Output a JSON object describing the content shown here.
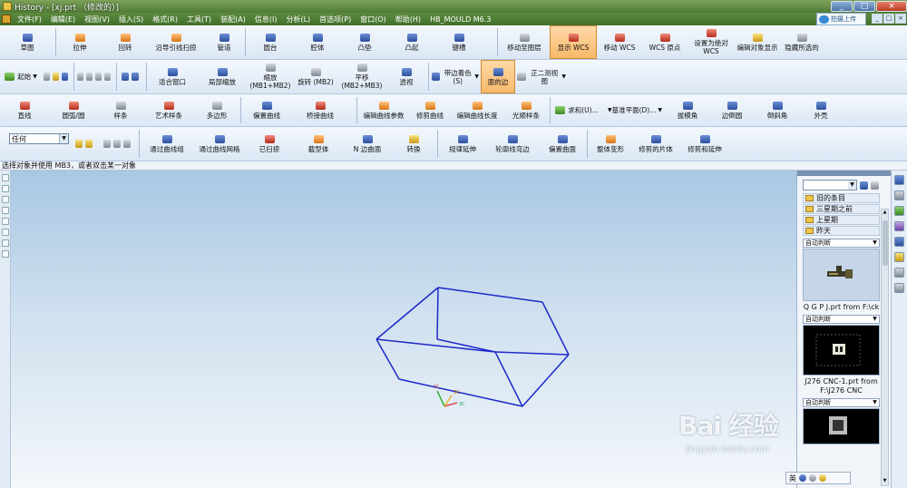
{
  "window": {
    "title": "History - [xj.prt （修改的）]",
    "controls": [
      "_",
      "□",
      "×"
    ]
  },
  "menu": {
    "items": [
      "文件(F)",
      "编辑(E)",
      "视图(V)",
      "插入(S)",
      "格式(R)",
      "工具(T)",
      "装配(A)",
      "信息(I)",
      "分析(L)",
      "首选项(P)",
      "窗口(O)",
      "帮助(H)",
      "HB_MOULD M6.3"
    ],
    "cloud_button": "拍摄上传",
    "doc_controls": [
      "_",
      "□",
      "×"
    ]
  },
  "toolbar1": {
    "items": [
      "草图",
      "拉伸",
      "回转",
      "沿导引线扫掠",
      "管道",
      "圆台",
      "腔体",
      "凸垫",
      "凸起",
      "键槽",
      "移动至图层",
      "显示 WCS",
      "移动 WCS",
      "WCS 原点",
      "设置为绝对 WCS",
      "编辑对象显示",
      "隐藏所选的"
    ],
    "active": "显示 WCS"
  },
  "toolbar2": {
    "start_label": "起始",
    "items": [
      "适合窗口",
      "局部缩放",
      "缩放 (MB1+MB2)",
      "旋转 (MB2)",
      "平移 (MB2+MB3)",
      "透视",
      "带边着色(S)",
      "面的边",
      "正二测视图"
    ],
    "active": "面的边"
  },
  "toolbar3": {
    "items": [
      "直线",
      "圆弧/圆",
      "样条",
      "艺术样条",
      "多边形",
      "偏置曲线",
      "桥接曲线",
      "编辑曲线参数",
      "修剪曲线",
      "编辑曲线长度",
      "光顺样条",
      "求和(U)...",
      "基准平面(D)...",
      "拔模角",
      "边倒圆",
      "倒斜角",
      "外壳"
    ]
  },
  "toolbar4": {
    "selection_filter": "任何",
    "items": [
      "通过曲线组",
      "通过曲线网格",
      "已扫掠",
      "截型体",
      "N 边曲面",
      "转换",
      "规律延伸",
      "轮廓线弯边",
      "偏置曲面",
      "整体变形",
      "修剪的片体",
      "修剪和延伸"
    ]
  },
  "status_line": "选择对象并使用 MB3，或者双击某一对象",
  "history_panel": {
    "folders": [
      "旧的条目",
      "三星期之前",
      "上星期",
      "昨天"
    ],
    "combo_label": "自动判断",
    "entries": [
      {
        "caption": "Q G P J.prt from F:\\ck"
      },
      {
        "caption": "J276 CNC-1.prt from F:\\J276 CNC"
      }
    ]
  },
  "ime_bar": {
    "label": "英"
  },
  "watermark": {
    "brand": "Bai 经验",
    "url": "jingyan.baidu.com"
  },
  "colors": {
    "model_edges": "#1c29c8",
    "active_tool": "#f7b96a",
    "axis_x": "#d33",
    "axis_y": "#2a2",
    "axis_z": "#e8b020"
  },
  "csys_labels": {
    "x": "XC",
    "y": "YC",
    "z": "ZC"
  }
}
